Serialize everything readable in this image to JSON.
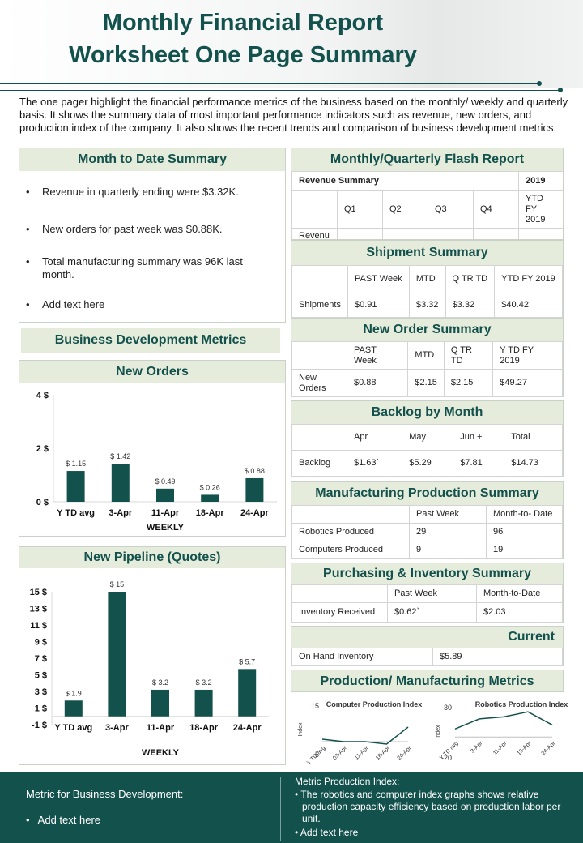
{
  "header": {
    "title_line1": "Monthly Financial Report",
    "title_line2": "Worksheet One Page Summary"
  },
  "intro": "The one pager highlight the financial performance metrics of the business based on the monthly/ weekly and quarterly basis. It shows the summary data of most important performance indicators such as  revenue, new orders, and production index of the company. It also shows the recent trends and comparison of business development metrics.",
  "mtd": {
    "title": "Month to Date Summary",
    "bullets": [
      "Revenue in quarterly ending were $3.32K.",
      "New orders for past week was $0.88K.",
      "Total manufacturing summary was 96K last month.",
      "Add text here"
    ]
  },
  "bdm": {
    "title": "Business Development Metrics"
  },
  "flash": {
    "title": "Monthly/Quarterly Flash Report",
    "revenue_summary_label": "Revenue Summary",
    "year": "2019",
    "quarters": [
      "Q1",
      "Q2",
      "Q3",
      "Q4",
      "YTD FY 2019"
    ],
    "row_label": "Revenu"
  },
  "shipment": {
    "title": "Shipment Summary",
    "headers": [
      "PAST Week",
      "MTD",
      "Q TR TD",
      "YTD FY 2019"
    ],
    "row_label": "Shipments",
    "values": [
      "$0.91",
      "$3.32",
      "$3.32",
      "$40.42"
    ]
  },
  "new_order": {
    "title": "New Order Summary",
    "headers": [
      "PAST Week",
      "MTD",
      "Q TR TD",
      "Y TD FY 2019"
    ],
    "row_label": "New Orders",
    "values": [
      "$0.88",
      "$2.15",
      "$2.15",
      "$49.27"
    ]
  },
  "backlog": {
    "title": "Backlog by Month",
    "headers": [
      "Apr",
      "May",
      "Jun +",
      "Total"
    ],
    "row_label": "Backlog",
    "values": [
      "$1.63`",
      "$5.29",
      "$7.81",
      "$14.73"
    ]
  },
  "manufacturing": {
    "title": "Manufacturing Production Summary",
    "headers": [
      "Past Week",
      "Month-to- Date"
    ],
    "rows": [
      {
        "label": "Robotics Produced",
        "values": [
          "29",
          "96"
        ]
      },
      {
        "label": "Computers Produced",
        "values": [
          "9",
          "19"
        ]
      }
    ]
  },
  "purchasing": {
    "title": "Purchasing & Inventory Summary",
    "headers": [
      "Past Week",
      "Month-to-Date"
    ],
    "row_label": "Inventory Received",
    "values": [
      "$0.62`",
      "$2.03"
    ]
  },
  "current": {
    "title": "Current",
    "row_label": "On Hand Inventory",
    "value": "$5.89"
  },
  "prod_metrics": {
    "title": "Production/ Manufacturing Metrics"
  },
  "footer": {
    "left_title": "Metric for Business Development:",
    "left_bullet": "Add text here",
    "right_title": "Metric Production Index:",
    "right_bullets": [
      "The robotics and computer index graphs shows relative production capacity efficiency based on production labor per unit.",
      "Add text here"
    ]
  },
  "colors": {
    "accent": "#13514c",
    "panel_header": "#e5ecdc"
  },
  "chart_data": [
    {
      "type": "bar",
      "title": "New Orders",
      "categories": [
        "Y TD avg",
        "3-Apr",
        "11-Apr",
        "18-Apr",
        "24-Apr"
      ],
      "values": [
        1.15,
        1.42,
        0.49,
        0.26,
        0.88
      ],
      "value_labels": [
        "$ 1.15",
        "$ 1.42",
        "$ 0.49",
        "$ 0.26",
        "$ 0.88"
      ],
      "xlabel": "WEEKLY",
      "ylim": [
        0,
        4
      ],
      "yticks": [
        0,
        2,
        4
      ],
      "ytick_labels": [
        "0 $",
        "2 $",
        "4 $"
      ]
    },
    {
      "type": "bar",
      "title": "New Pipeline (Quotes)",
      "categories": [
        "Y TD avg",
        "3-Apr",
        "11-Apr",
        "18-Apr",
        "24-Apr"
      ],
      "values": [
        1.9,
        15,
        3.2,
        3.2,
        5.7
      ],
      "value_labels": [
        "$ 1.9",
        "$ 15",
        "$ 3.2",
        "$ 3.2",
        "$ 5.7"
      ],
      "xlabel": "WEEKLY",
      "ylim": [
        -1,
        15
      ],
      "yticks": [
        -1,
        1,
        3,
        5,
        7,
        9,
        11,
        13,
        15
      ],
      "ytick_labels": [
        "-1 $",
        "1 $",
        "3 $",
        "5 $",
        "7 $",
        "9 $",
        "11 $",
        "13 $",
        "15 $"
      ]
    },
    {
      "type": "line",
      "title": "Computer Production Index",
      "categories": [
        "Y TD avg",
        "03-Apr",
        "11-Apr",
        "18-Apr",
        "24-Apr"
      ],
      "values": [
        1,
        0,
        0,
        -1,
        6
      ],
      "ylabel": "Index",
      "ylim": [
        -5,
        15
      ],
      "ytick_labels": [
        "-5",
        "15"
      ]
    },
    {
      "type": "line",
      "title": "Robotics Production Index",
      "categories": [
        "Y TD avg",
        "3-Apr",
        "11-Apr",
        "18-Apr",
        "24-Apr"
      ],
      "values": [
        8,
        18,
        20,
        25,
        12
      ],
      "ylabel": "Index",
      "ylim": [
        -20,
        30
      ],
      "ytick_labels": [
        "-20",
        "30"
      ]
    }
  ]
}
